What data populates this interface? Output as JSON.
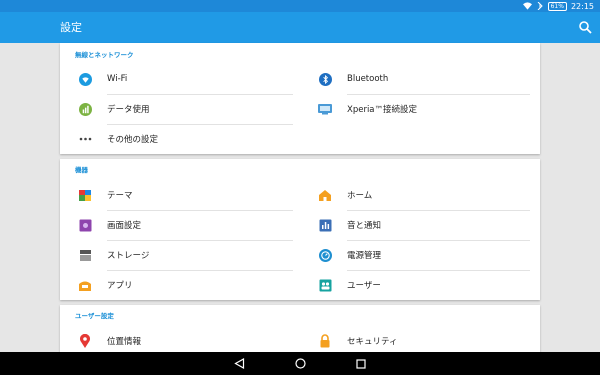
{
  "status": {
    "time": "22:15",
    "battery": "61%"
  },
  "appbar": {
    "title": "設定"
  },
  "sections": {
    "wireless": {
      "title": "無線とネットワーク",
      "items": [
        "Wi-Fi",
        "Bluetooth",
        "データ使用",
        "Xperia™接続設定",
        "その他の設定"
      ]
    },
    "device": {
      "title": "機器",
      "items": [
        "テーマ",
        "ホーム",
        "画面設定",
        "音と通知",
        "ストレージ",
        "電源管理",
        "アプリ",
        "ユーザー"
      ]
    },
    "user": {
      "title": "ユーザー設定",
      "items": [
        "位置情報",
        "セキュリティ"
      ]
    }
  },
  "colors": {
    "appbar": "#209ae6",
    "statusbar": "#1e88d8",
    "section_title": "#1a8fd6"
  },
  "icons": [
    "wifi-icon",
    "bluetooth-icon",
    "data-usage-icon",
    "xperia-connect-icon",
    "more-icon",
    "theme-icon",
    "home-icon",
    "display-icon",
    "sound-icon",
    "storage-icon",
    "battery-icon",
    "apps-icon",
    "users-icon",
    "location-icon",
    "security-icon"
  ]
}
